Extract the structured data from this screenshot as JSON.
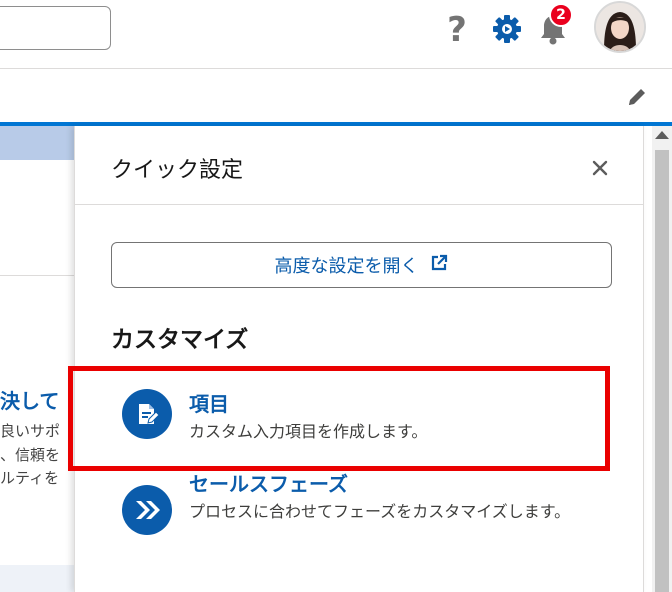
{
  "header": {
    "help_icon": "?",
    "notification_count": "2",
    "icons": [
      "help-icon",
      "setup-gear-icon",
      "notifications-bell-icon",
      "user-avatar",
      "edit-pencil-icon"
    ],
    "accent": "#0176d3"
  },
  "background_page": {
    "heading_fragment": "決して",
    "line1": "良いサポ",
    "line2": "、信頼を",
    "line3": "ルティを"
  },
  "quick_settings": {
    "title": "クイック設定",
    "advanced_button": "高度な設定を開く",
    "section_heading": "カスタマイズ",
    "options": [
      {
        "title": "項目",
        "description": "カスタム入力項目を作成します。",
        "icon": "document-edit-icon"
      },
      {
        "title": "セールスフェーズ",
        "description": "プロセスに合わせてフェーズをカスタマイズします。",
        "icon": "double-chevron-right-icon"
      }
    ]
  },
  "colors": {
    "brand_blue": "#0b5cab",
    "highlight_red": "#ea0000",
    "badge_red": "#ea001e"
  }
}
